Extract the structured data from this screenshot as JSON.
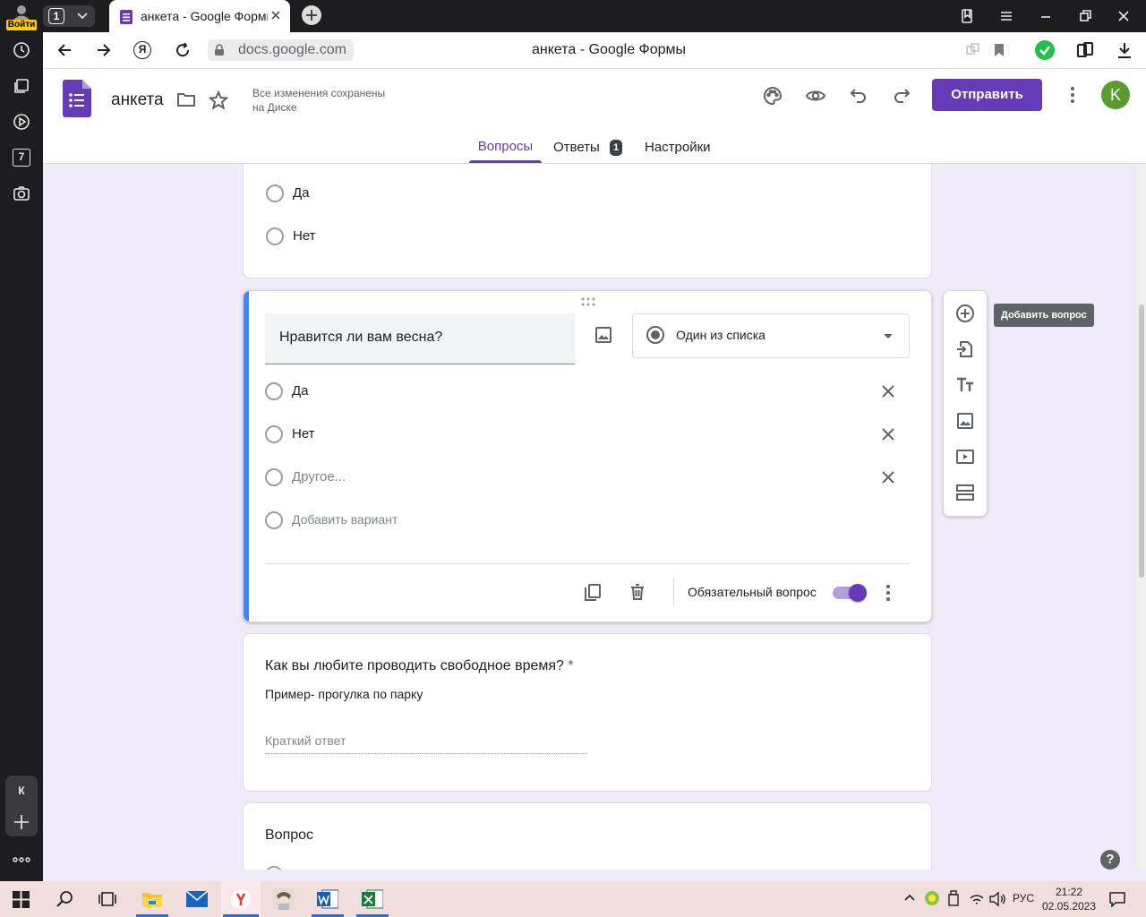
{
  "browser": {
    "login_label": "Войти",
    "tab_counter": "1",
    "tab_title": "анкета - Google Формы",
    "url": "docs.google.com",
    "page_title": "анкета - Google Формы"
  },
  "rail": {
    "badge_seven": "7",
    "profile_letter": "К"
  },
  "header": {
    "doc_title": "анкета",
    "save_status_line1": "Все изменения сохранены",
    "save_status_line2": "на Диске",
    "send_label": "Отправить",
    "avatar_letter": "K",
    "accent_color": "#673ab7"
  },
  "tabs": {
    "questions": "Вопросы",
    "answers": "Ответы",
    "answers_count": "1",
    "settings": "Настройки"
  },
  "card_top": {
    "options": [
      "Да",
      "Нет"
    ]
  },
  "card_active": {
    "question": "Нравится ли вам весна?",
    "type_label": "Один из списка",
    "options": [
      "Да",
      "Нет"
    ],
    "other_label": "Другое...",
    "add_option_label": "Добавить вариант",
    "required_label": "Обязательный вопрос",
    "required_on": true
  },
  "card_short": {
    "question": "Как вы любите проводить свободное время?",
    "required_mark": "*",
    "description": "Пример- прогулка по парку",
    "answer_placeholder": "Краткий ответ"
  },
  "card_bottom": {
    "question": "Вопрос"
  },
  "side_toolbar": {
    "tooltip": "Добавить вопрос",
    "icons": [
      "add-question-icon",
      "import-questions-icon",
      "title-text-icon",
      "image-icon",
      "video-icon",
      "section-icon"
    ]
  },
  "taskbar": {
    "language": "РУС",
    "time": "21:22",
    "date": "02.05.2023"
  }
}
